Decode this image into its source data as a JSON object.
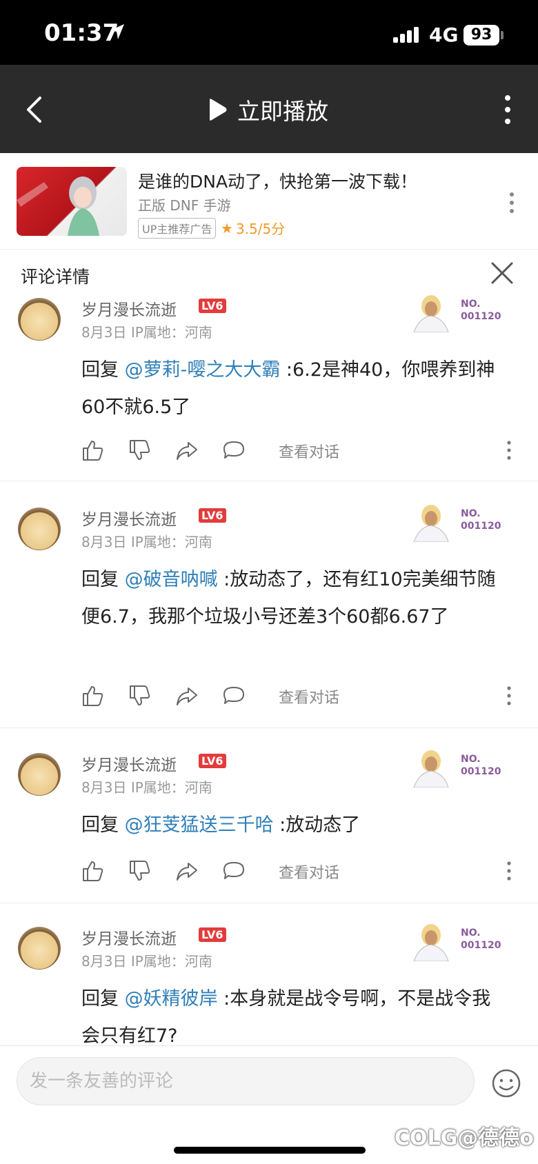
{
  "status_bar": {
    "time": "01:37",
    "network": "4G",
    "battery": "93"
  },
  "nav": {
    "play_label": "立即播放"
  },
  "ad": {
    "title": "是谁的DNA动了，快抢第一波下载！",
    "subtitle": "正版 DNF 手游",
    "tag": "UP主推荐广告",
    "rating": "3.5/5分"
  },
  "comment_panel": {
    "title": "评论详情"
  },
  "comments": [
    {
      "username": "岁月漫长流逝",
      "level": "LV6",
      "date": "8月3日",
      "ip": "IP属地：河南",
      "decor_no": "NO.",
      "decor_id": "001120",
      "reply_prefix": "回复 ",
      "mention": "@萝莉-嘤之大大霸",
      "text": " :6.2是神40，你喂养到神60不就6.5了",
      "view_convo": "查看对话"
    },
    {
      "username": "岁月漫长流逝",
      "level": "LV6",
      "date": "8月3日",
      "ip": "IP属地：河南",
      "decor_no": "NO.",
      "decor_id": "001120",
      "reply_prefix": "回复 ",
      "mention": "@破音呐喊",
      "text": " :放动态了，还有红10完美细节随便6.7，我那个垃圾小号还差3个60都6.67了",
      "view_convo": "查看对话"
    },
    {
      "username": "岁月漫长流逝",
      "level": "LV6",
      "date": "8月3日",
      "ip": "IP属地：河南",
      "decor_no": "NO.",
      "decor_id": "001120",
      "reply_prefix": "回复 ",
      "mention": "@狂芰猛送三千哈",
      "text": " :放动态了",
      "view_convo": "查看对话"
    },
    {
      "username": "岁月漫长流逝",
      "level": "LV6",
      "date": "8月3日",
      "ip": "IP属地：河南",
      "decor_no": "NO.",
      "decor_id": "001120",
      "reply_prefix": "回复 ",
      "mention": "@妖精彼岸",
      "text": " :本身就是战令号啊，不是战令我会只有红7?"
    }
  ],
  "input": {
    "placeholder": "发一条友善的评论"
  },
  "watermark": "COLG@德德o"
}
